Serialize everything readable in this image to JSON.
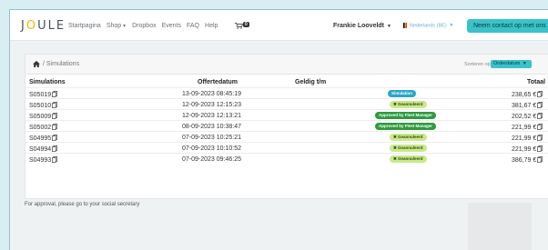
{
  "brand": {
    "logo": "J",
    "logo_o": "O",
    "logo_rest": "ULE"
  },
  "nav": {
    "items": [
      {
        "label": "Startpagina"
      },
      {
        "label": "Shop",
        "dropdown": true
      },
      {
        "label": "Dropbox"
      },
      {
        "label": "Events"
      },
      {
        "label": "FAQ"
      },
      {
        "label": "Help"
      }
    ],
    "cart_count": "0"
  },
  "user": {
    "name": "Frankie Looveldt"
  },
  "language": {
    "label": "Nederlands (BE)"
  },
  "contact_button": {
    "label": "Neem contact op met ons"
  },
  "breadcrumb": {
    "current": "Simulations"
  },
  "sort": {
    "label": "Sorteren op:",
    "selected": "Orderdatum"
  },
  "table": {
    "headers": {
      "id": "Simulations",
      "date": "Offertedatum",
      "valid": "Geldig t/m",
      "total": "Totaal"
    },
    "rows": [
      {
        "id": "S05019",
        "date": "13-09-2023 08:45:19",
        "status": "Simulation",
        "status_type": "simulation",
        "total": "238,65 €"
      },
      {
        "id": "S05010",
        "date": "12-09-2023 12:15:23",
        "status": "✖ Geannuleerd",
        "status_type": "cancelled",
        "total": "381,67 €"
      },
      {
        "id": "S05009",
        "date": "12-09-2023 12:13:21",
        "status": "Approved by Fleet Manager",
        "status_type": "approved",
        "total": "202,52 €"
      },
      {
        "id": "S05002",
        "date": "08-09-2023 10:38:47",
        "status": "Approved by Fleet Manager",
        "status_type": "approved",
        "total": "221,99 €"
      },
      {
        "id": "S04995",
        "date": "07-09-2023 10:25:21",
        "status": "✖ Geannuleerd",
        "status_type": "cancelled",
        "total": "221,99 €"
      },
      {
        "id": "S04994",
        "date": "07-09-2023 10:10:52",
        "status": "✖ Geannuleerd",
        "status_type": "cancelled",
        "total": "221,99 €"
      },
      {
        "id": "S04993",
        "date": "07-09-2023 09:46:25",
        "status": "✖ Geannuleerd",
        "status_type": "cancelled",
        "total": "386,79 €"
      }
    ]
  },
  "footer_note": "For approval, please go to your social secretary",
  "colors": {
    "accent": "#39c3c9",
    "simulation": "#2aa7c9",
    "approved": "#2e9a3e",
    "cancelled": "#c9e98a"
  }
}
